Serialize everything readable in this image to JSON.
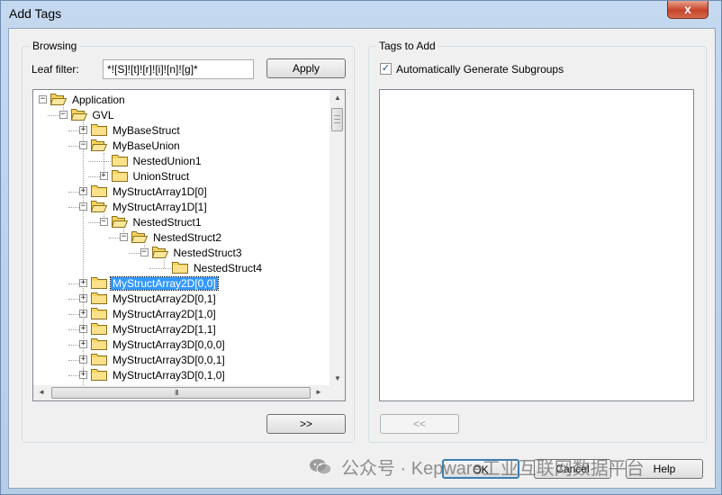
{
  "window": {
    "title": "Add Tags",
    "close_glyph": "x",
    "accent_color": "#3399ff"
  },
  "browsing": {
    "group_label": "Browsing",
    "leaf_filter_label": "Leaf filter:",
    "leaf_filter_value": "*![S]![t]![r]![i]![n]![g]*",
    "apply_label": "Apply",
    "add_label": ">>",
    "tree": [
      {
        "label": "Application",
        "level": 0,
        "expander": "minus",
        "state": "open"
      },
      {
        "label": "GVL",
        "level": 1,
        "expander": "minus",
        "state": "open"
      },
      {
        "label": "MyBaseStruct",
        "level": 2,
        "expander": "plus",
        "state": "closed"
      },
      {
        "label": "MyBaseUnion",
        "level": 2,
        "expander": "minus",
        "state": "open"
      },
      {
        "label": "NestedUnion1",
        "level": 3,
        "expander": "none",
        "state": "closed"
      },
      {
        "label": "UnionStruct",
        "level": 3,
        "expander": "plus",
        "state": "closed"
      },
      {
        "label": "MyStructArray1D[0]",
        "level": 2,
        "expander": "plus",
        "state": "closed"
      },
      {
        "label": "MyStructArray1D[1]",
        "level": 2,
        "expander": "minus",
        "state": "open"
      },
      {
        "label": "NestedStruct1",
        "level": 3,
        "expander": "minus",
        "state": "open"
      },
      {
        "label": "NestedStruct2",
        "level": 4,
        "expander": "minus",
        "state": "open"
      },
      {
        "label": "NestedStruct3",
        "level": 5,
        "expander": "minus",
        "state": "open"
      },
      {
        "label": "NestedStruct4",
        "level": 6,
        "expander": "none",
        "state": "closed"
      },
      {
        "label": "MyStructArray2D[0,0]",
        "level": 2,
        "expander": "plus",
        "state": "closed",
        "selected": true
      },
      {
        "label": "MyStructArray2D[0,1]",
        "level": 2,
        "expander": "plus",
        "state": "closed"
      },
      {
        "label": "MyStructArray2D[1,0]",
        "level": 2,
        "expander": "plus",
        "state": "closed"
      },
      {
        "label": "MyStructArray2D[1,1]",
        "level": 2,
        "expander": "plus",
        "state": "closed"
      },
      {
        "label": "MyStructArray3D[0,0,0]",
        "level": 2,
        "expander": "plus",
        "state": "closed"
      },
      {
        "label": "MyStructArray3D[0,0,1]",
        "level": 2,
        "expander": "plus",
        "state": "closed"
      },
      {
        "label": "MyStructArray3D[0,1,0]",
        "level": 2,
        "expander": "plus",
        "state": "closed"
      }
    ],
    "scroll_grip": "III"
  },
  "tags": {
    "group_label": "Tags to Add",
    "auto_subgroups_label": "Automatically Generate Subgroups",
    "auto_subgroups_checked": true,
    "remove_label": "<<"
  },
  "footer": {
    "ok_label": "OK",
    "cancel_label": "Cancel",
    "help_label": "Help",
    "watermark_text": "公众号 · Kepware工业互联网数据平台"
  }
}
